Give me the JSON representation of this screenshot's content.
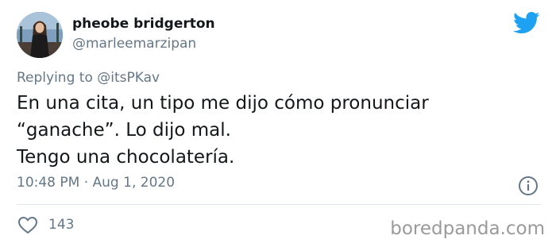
{
  "author": {
    "display_name": "pheobe bridgerton",
    "handle": "@marleemarzipan"
  },
  "reply": {
    "prefix": "Replying to",
    "mention": "@itsPKav"
  },
  "tweet": {
    "lines": [
      "En una cita, un tipo me dijo cómo pronunciar",
      "“ganache”. Lo dijo mal.",
      "Tengo una chocolatería."
    ],
    "timestamp": "10:48 PM · Aug 1, 2020"
  },
  "actions": {
    "like_count": "143"
  },
  "watermark": "boredpanda.com",
  "icons": {
    "brand": "twitter-bird-icon",
    "info": "info-icon",
    "like": "heart-icon"
  },
  "colors": {
    "twitter_blue": "#1da1f2",
    "text_primary": "#14171a",
    "text_secondary": "#657786"
  }
}
